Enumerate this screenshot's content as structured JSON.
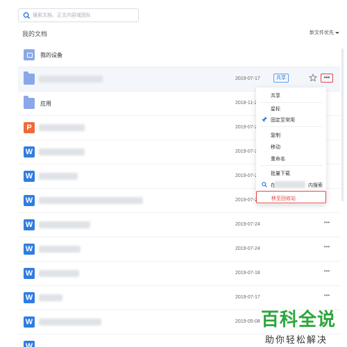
{
  "search": {
    "placeholder": "搜索文档、正文内容或团队"
  },
  "section_title": "我的文档",
  "sort_label": "新文件优先",
  "rows": [
    {
      "icon": "device",
      "name": "我的设备",
      "date": ""
    },
    {
      "icon": "folder",
      "name": "",
      "date": "2019-07-17",
      "share": "共享"
    },
    {
      "icon": "folder",
      "name": "应用",
      "date": "2018-11-27"
    },
    {
      "icon": "ppt",
      "icon_glyph": "P",
      "name": "",
      "date": "2019-07-26"
    },
    {
      "icon": "doc",
      "icon_glyph": "W",
      "name": "",
      "date": "2019-07-24"
    },
    {
      "icon": "doc",
      "icon_glyph": "W",
      "name": "",
      "date": "2019-07-24"
    },
    {
      "icon": "doc",
      "icon_glyph": "W",
      "name": "",
      "date": "2019-07-24"
    },
    {
      "icon": "doc",
      "icon_glyph": "W",
      "name": "",
      "date": "2019-07-24"
    },
    {
      "icon": "doc",
      "icon_glyph": "W",
      "name": "",
      "date": "2019-07-24"
    },
    {
      "icon": "doc",
      "icon_glyph": "W",
      "name": "",
      "date": "2019-07-18"
    },
    {
      "icon": "doc",
      "icon_glyph": "W",
      "name": "",
      "date": "2019-07-17"
    },
    {
      "icon": "doc",
      "icon_glyph": "W",
      "name": "",
      "date": "2019-05-08"
    },
    {
      "icon": "doc",
      "icon_glyph": "W",
      "name": "",
      "date": ""
    }
  ],
  "more_label": "•••",
  "context_menu": {
    "share": "共享",
    "star": "星标",
    "pin": "固定至常用",
    "copy": "复制",
    "move": "移动",
    "rename": "重命名",
    "download": "批量下载",
    "search_prefix": "在",
    "search_suffix": "内搜索",
    "trash": "移至回收站"
  },
  "watermark": {
    "line1": "百科全说",
    "line2": "助你轻松解决"
  },
  "colors": {
    "accent": "#2f7de1",
    "danger": "#e64545",
    "folder": "#8aa8e8",
    "ppt": "#ee6a3a",
    "watermark_green": "#2aa63a"
  }
}
